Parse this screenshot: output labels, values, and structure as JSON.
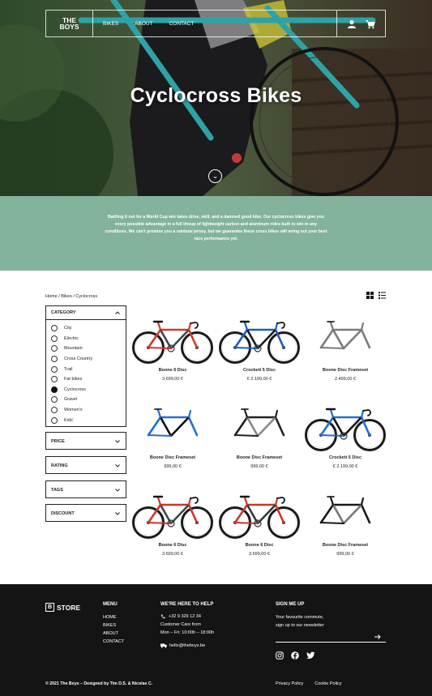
{
  "hero": {
    "title": "Cyclocross Bikes",
    "logo_line1": "THE",
    "logo_line2": "BOYS",
    "nav": [
      "BIKES",
      "ABOUT",
      "CONTACT"
    ]
  },
  "intro": {
    "text": "Battling it out for a World Cup win takes drive, skill, and a damned good bike. Our cyclocross bikes give you every possible advantage in a full lineup of lightweight carbon and aluminum rides built to win in any conditions. We can't promise you a rainbow jersey, but we guarantee these cross bikes will wring out your best race performance yet."
  },
  "breadcrumb": "Home / Bikes / Cyclocross",
  "filters": {
    "category": {
      "label": "CATEGORY",
      "options": [
        "City",
        "Electric",
        "Mountain",
        "Cross Country",
        "Trail",
        "Fat bikes",
        "Cyclocross",
        "Gravel",
        "Women's",
        "Kids'"
      ],
      "selected": "Cyclocross"
    },
    "closed": [
      "PRICE",
      "RATING",
      "TAGS",
      "DISCOUNT"
    ]
  },
  "products": [
    {
      "name": "Boone 6 Disc",
      "price": "3.699,00 €",
      "kind": "bike",
      "frame_color": "#d03a2a",
      "tube_color": "#3b4a55"
    },
    {
      "name": "Crockett 5 Disc",
      "price": "€ 2.199,00 €",
      "kind": "bike",
      "frame_color": "#1f5fb8",
      "tube_color": "#1b1b1b"
    },
    {
      "name": "Boone Disc Frameset",
      "price": "2.499,00 €",
      "kind": "frame",
      "frame_color": "#7a7a7a",
      "tube_color": "#7a7a7a"
    },
    {
      "name": "Boone Disc Frameset",
      "price": "999,00 €",
      "kind": "frame",
      "frame_color": "#1f6fd0",
      "tube_color": "#111111"
    },
    {
      "name": "Boone Disc Frameset",
      "price": "999,00 €",
      "kind": "frame",
      "frame_color": "#222222",
      "tube_color": "#888888"
    },
    {
      "name": "Crockett 5 Disc",
      "price": "€ 2.199,00 €",
      "kind": "bike",
      "frame_color": "#1f6fd0",
      "tube_color": "#111111"
    },
    {
      "name": "Boone 6 Disc",
      "price": "3.699,00 €",
      "kind": "bike",
      "frame_color": "#c8392b",
      "tube_color": "#3a4a50"
    },
    {
      "name": "Boone 6 Disc",
      "price": "3.699,00 €",
      "kind": "bike",
      "frame_color": "#c8392b",
      "tube_color": "#2f3c44"
    },
    {
      "name": "Boone Disc Frameset",
      "price": "999,00 €",
      "kind": "frame",
      "frame_color": "#1a1a1a",
      "tube_color": "#777777"
    }
  ],
  "footer": {
    "logo_letter": "B",
    "logo_text": "STORE",
    "menu_title": "MENU",
    "menu": [
      "HOME",
      "BIKES",
      "ABOUT",
      "CONTACT"
    ],
    "help_title": "WE'RE HERE TO HELP",
    "phone": "+32 9 329 12 34",
    "care_label": "Customer Care from",
    "hours": "Mon – Fri: 10:00h – 18:00h",
    "email": "hello@theboys.be",
    "signup_title": "SIGN ME UP",
    "signup_line1": "Your favourite commute,",
    "signup_line2": "sign up to our newsletter",
    "copyright": "© 2021 The Boys – Designed by Tim D.S. & Nicolas C.",
    "privacy": "Privacy Policy",
    "cookie": "Cookie Policy"
  },
  "colors": {
    "intro_bg": "#84b39d",
    "footer_bg": "#141414",
    "hero_bike": "#2ea3a7"
  }
}
